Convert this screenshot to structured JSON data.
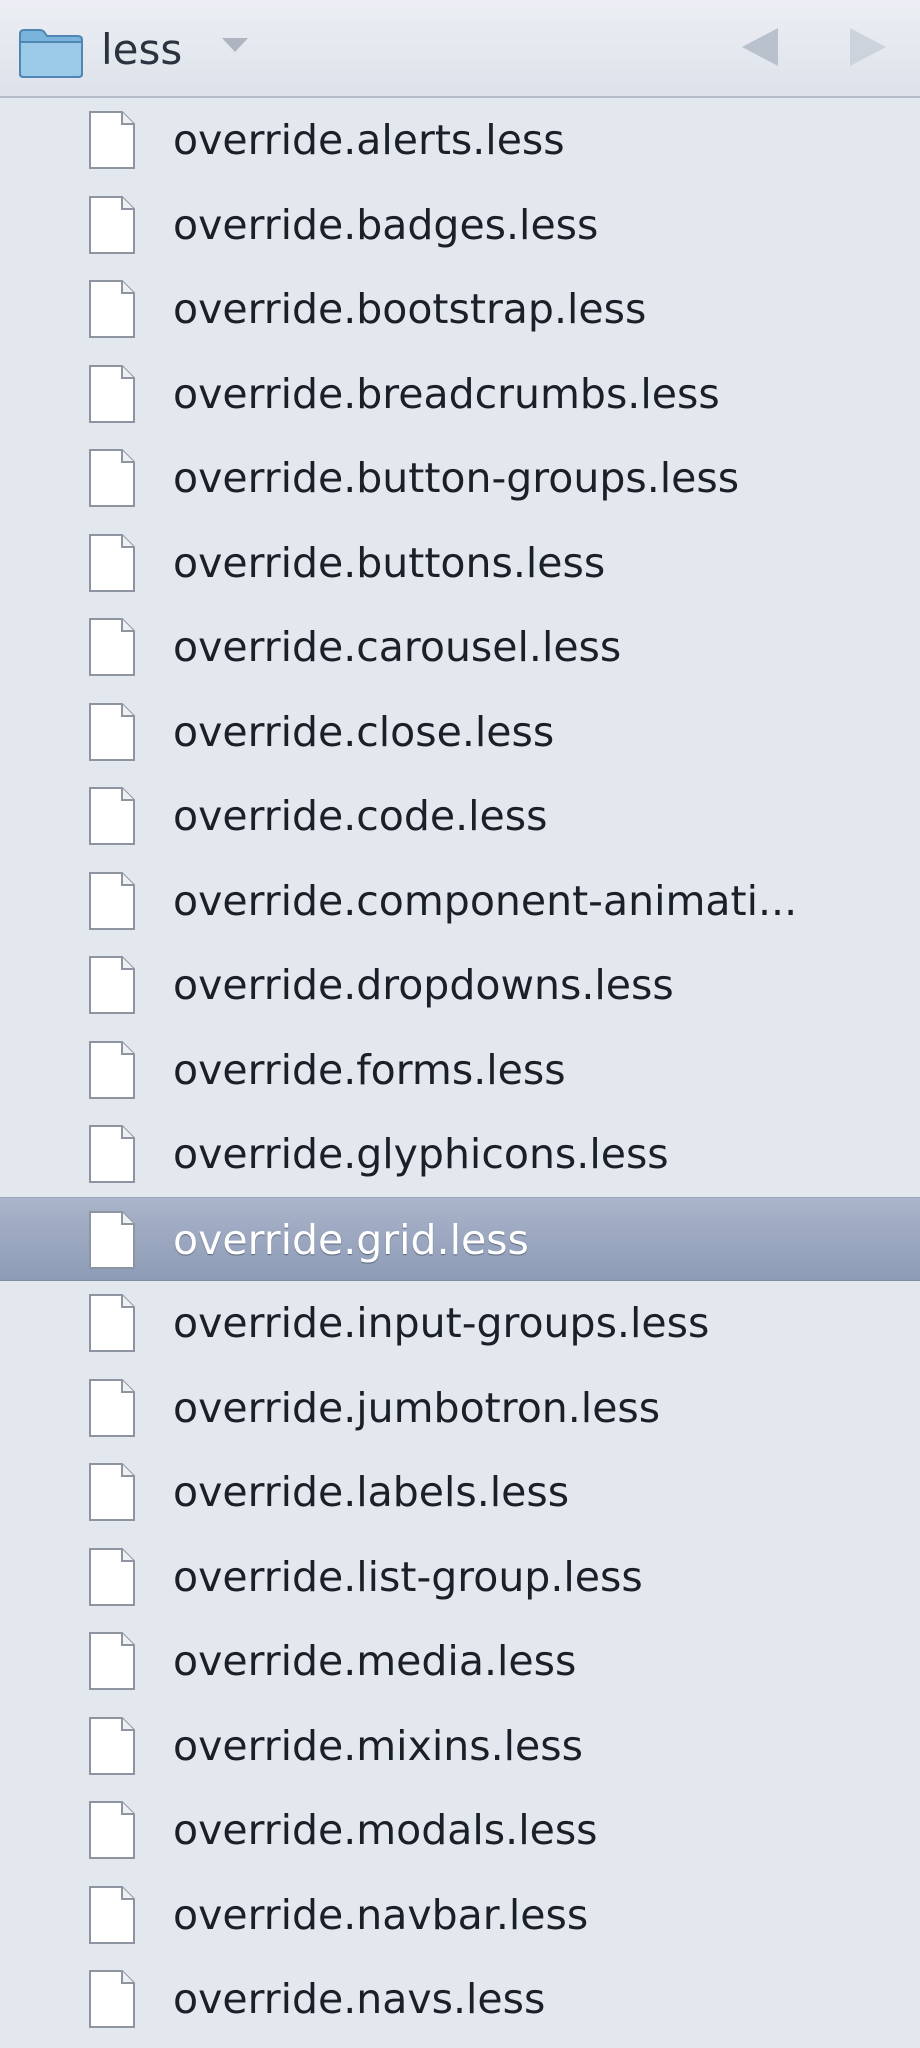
{
  "header": {
    "folder_name": "less",
    "folder_icon": "folder-icon",
    "back_icon": "back-arrow-icon",
    "forward_icon": "forward-arrow-icon"
  },
  "colors": {
    "background": "#e3e8ef",
    "selection": "#9aa6bf",
    "text": "#1b2028",
    "selected_text": "#ffffff"
  },
  "files": [
    {
      "name": "override.alerts.less"
    },
    {
      "name": "override.badges.less"
    },
    {
      "name": "override.bootstrap.less"
    },
    {
      "name": "override.breadcrumbs.less"
    },
    {
      "name": "override.button-groups.less"
    },
    {
      "name": "override.buttons.less"
    },
    {
      "name": "override.carousel.less"
    },
    {
      "name": "override.close.less"
    },
    {
      "name": "override.code.less"
    },
    {
      "name": "override.component-animati..."
    },
    {
      "name": "override.dropdowns.less"
    },
    {
      "name": "override.forms.less"
    },
    {
      "name": "override.glyphicons.less"
    },
    {
      "name": "override.grid.less",
      "selected": true
    },
    {
      "name": "override.input-groups.less"
    },
    {
      "name": "override.jumbotron.less"
    },
    {
      "name": "override.labels.less"
    },
    {
      "name": "override.list-group.less"
    },
    {
      "name": "override.media.less"
    },
    {
      "name": "override.mixins.less"
    },
    {
      "name": "override.modals.less"
    },
    {
      "name": "override.navbar.less"
    },
    {
      "name": "override.navs.less"
    }
  ]
}
